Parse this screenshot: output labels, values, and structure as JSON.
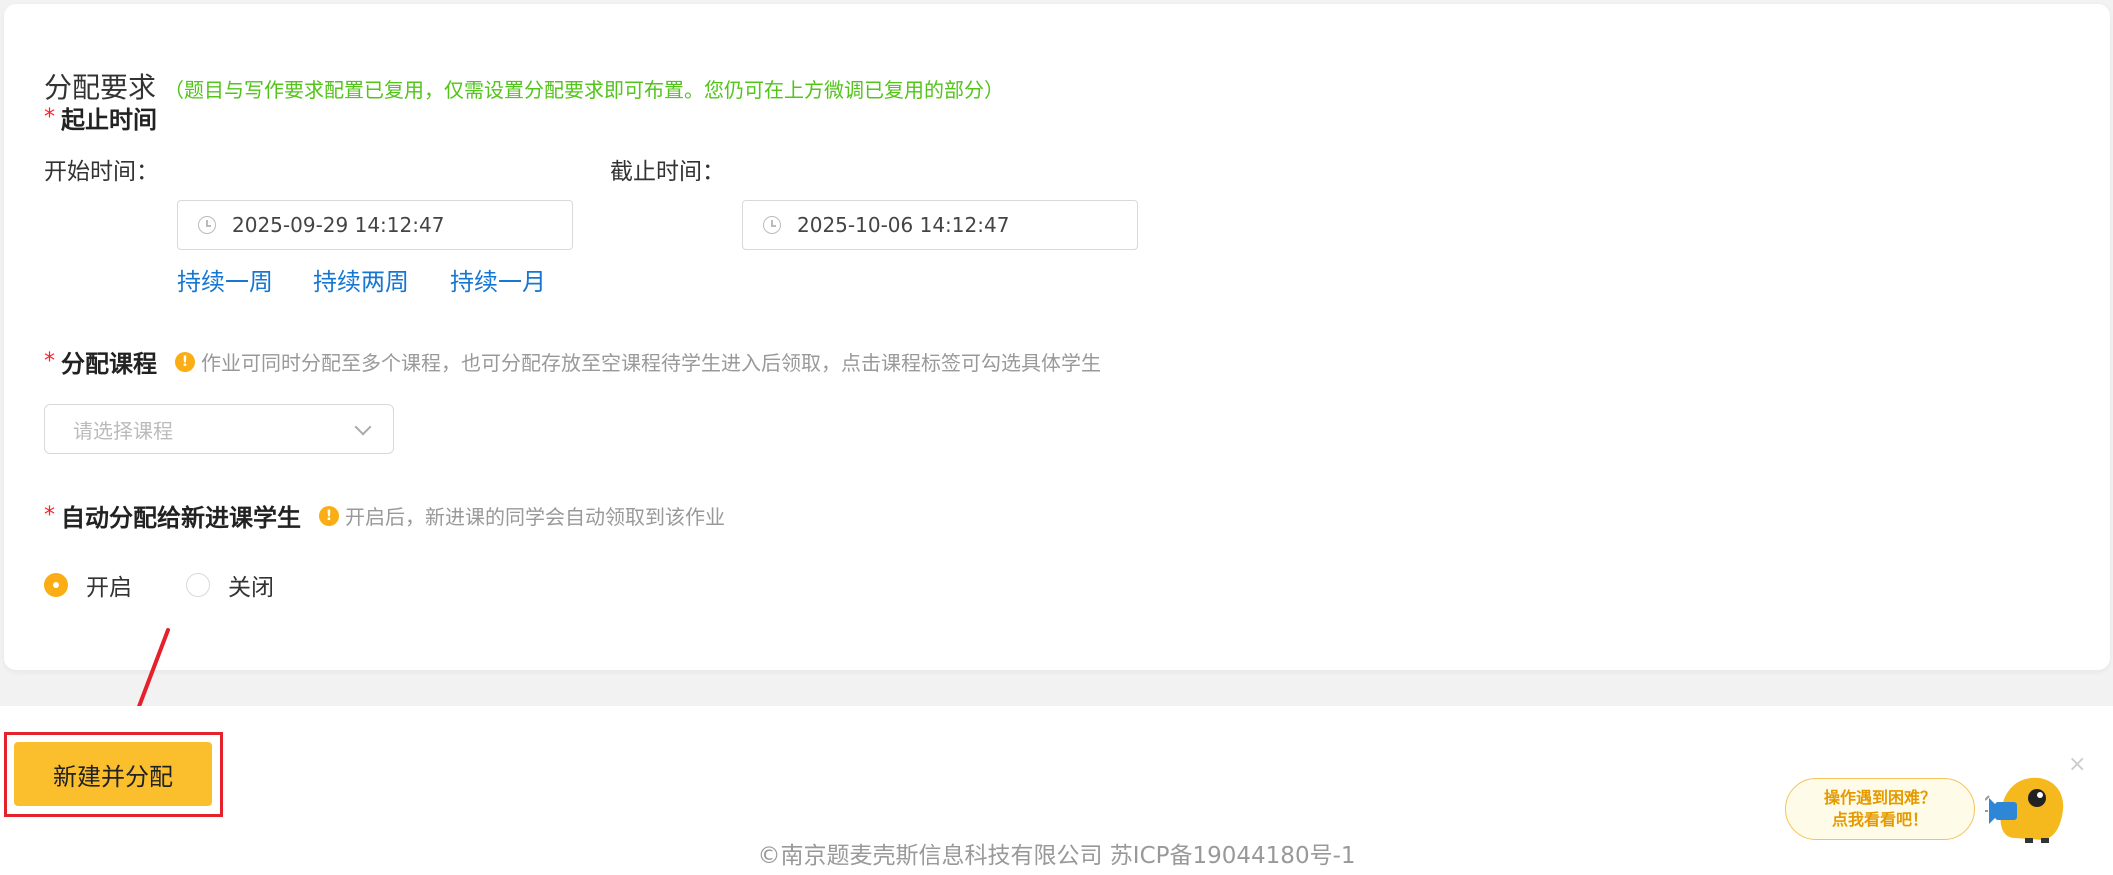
{
  "assignment": {
    "title": "分配要求",
    "note": "（题目与写作要求配置已复用，仅需设置分配要求即可布置。您仍可在上方微调已复用的部分）"
  },
  "time": {
    "section_label": "起止时间",
    "required_mark": "*",
    "start_label": "开始时间：",
    "start_value": "2025-09-29 14:12:47",
    "end_label": "截止时间：",
    "end_value": "2025-10-06 14:12:47",
    "quick_options": [
      "持续一周",
      "持续两周",
      "持续一月"
    ]
  },
  "course": {
    "label": "分配课程",
    "required_mark": "*",
    "hint": "作业可同时分配至多个课程，也可分配存放至空课程待学生进入后领取，点击课程标签可勾选具体学生",
    "placeholder": "请选择课程"
  },
  "auto_assign": {
    "label": "自动分配给新进课学生",
    "required_mark": "*",
    "hint": "开启后，新进课的同学会自动领取到该作业",
    "options": [
      "开启",
      "关闭"
    ],
    "selected": "开启"
  },
  "footer": {
    "primary_button": "新建并分配",
    "copyright": "©南京题麦壳斯信息科技有限公司 苏ICP备19044180号-1",
    "help_line1": "操作遇到困难？",
    "help_line2": "点我看看吧！",
    "close_symbol": "×"
  },
  "colors": {
    "accent": "#fbbf2d",
    "link": "#1677d2",
    "note_green": "#52c41a",
    "required_red": "#f5222d",
    "highlight_red": "#e5212b"
  }
}
